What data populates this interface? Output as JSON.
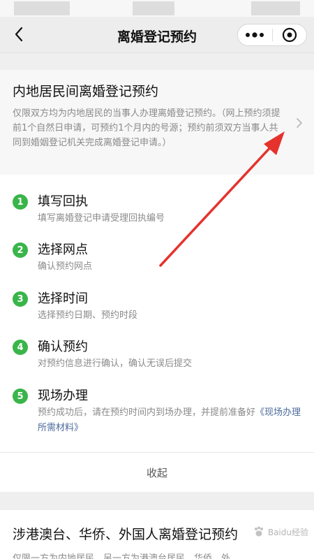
{
  "nav": {
    "title": "离婚登记预约",
    "back_icon": "chevron-left-icon",
    "more_icon": "more-dots-icon",
    "close_icon": "target-close-icon"
  },
  "section1": {
    "title": "内地居民间离婚登记预约",
    "description": "仅限双方均为内地居民的当事人办理离婚登记预约。（网上预约须提前1个自然日申请，可预约1个月内的号源；预约前须双方当事人共同到婚姻登记机关完成离婚登记申请。）"
  },
  "steps": [
    {
      "num": "1",
      "title": "填写回执",
      "desc": "填写离婚登记申请受理回执编号"
    },
    {
      "num": "2",
      "title": "选择网点",
      "desc": "确认预约网点"
    },
    {
      "num": "3",
      "title": "选择时间",
      "desc": "选择预约日期、预约时段"
    },
    {
      "num": "4",
      "title": "确认预约",
      "desc": "对预约信息进行确认，确认无误后提交"
    },
    {
      "num": "5",
      "title": "现场办理",
      "desc": "预约成功后，请在预约时间内到场办理，并提前准备好",
      "link": "《现场办理所需材料》"
    }
  ],
  "collapse_label": "收起",
  "section2": {
    "title": "涉港澳台、华侨、外国人离婚登记预约",
    "description": "仅限一方为内地居民，另一方为港澳台居民、华侨、外"
  },
  "watermark": "Baidu经验",
  "colors": {
    "step_badge": "#39b54a",
    "link": "#4b6a9b",
    "arrow": "#e5322d"
  }
}
